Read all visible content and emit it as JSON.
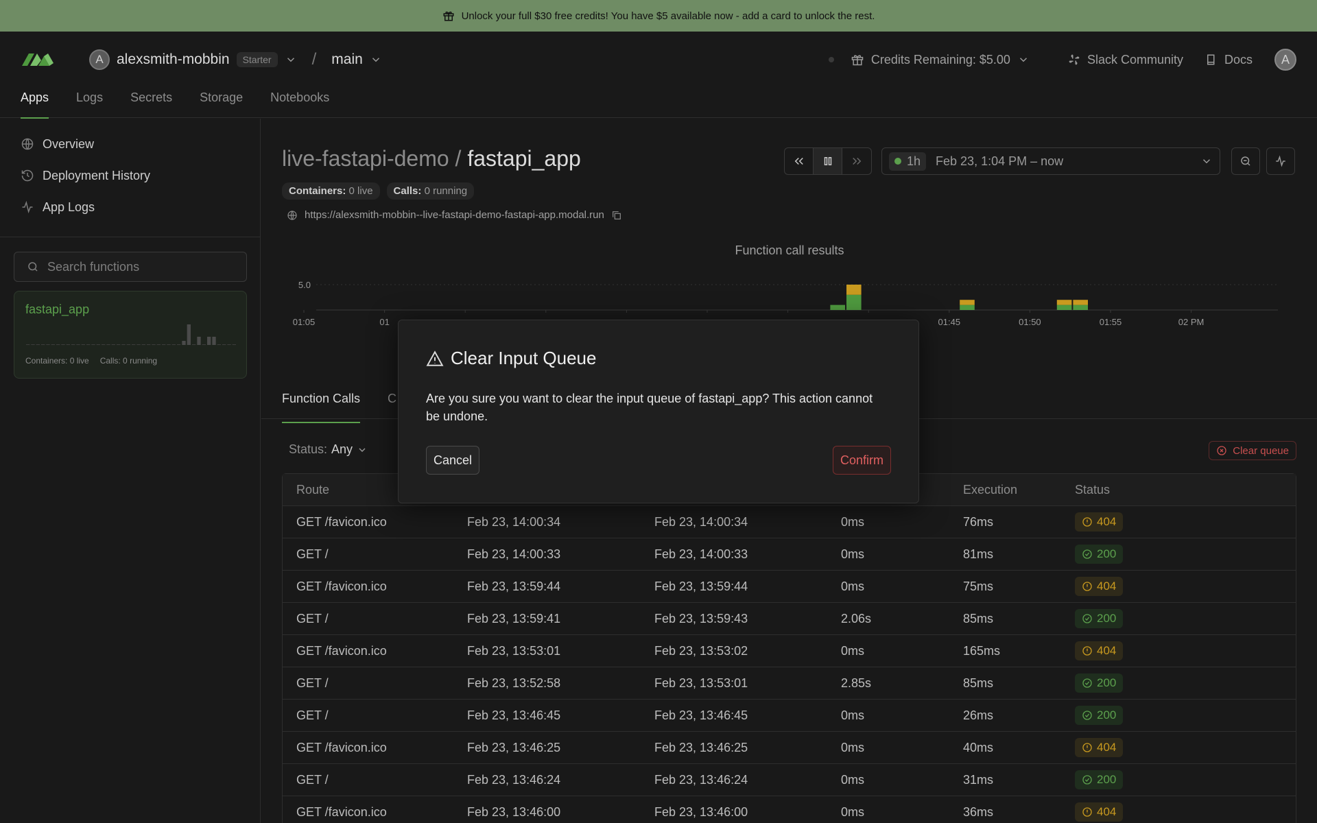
{
  "banner": {
    "text": "Unlock your full $30 free credits! You have $5 available now - add a card to unlock the rest."
  },
  "header": {
    "org_avatar": "A",
    "org_name": "alexsmith-mobbin",
    "plan": "Starter",
    "separator": "/",
    "branch": "main",
    "credits": "Credits Remaining: $5.00",
    "slack": "Slack Community",
    "docs": "Docs",
    "user_avatar": "A"
  },
  "nav": {
    "tabs": [
      {
        "label": "Apps",
        "active": true
      },
      {
        "label": "Logs"
      },
      {
        "label": "Secrets"
      },
      {
        "label": "Storage"
      },
      {
        "label": "Notebooks"
      }
    ]
  },
  "sidebar": {
    "links": [
      {
        "label": "Overview",
        "icon": "globe-icon"
      },
      {
        "label": "Deployment History",
        "icon": "history-icon"
      },
      {
        "label": "App Logs",
        "icon": "activity-icon"
      }
    ],
    "search_placeholder": "Search functions",
    "function_card": {
      "name": "fastapi_app",
      "containers": "Containers: 0 live",
      "calls": "Calls: 0 running",
      "sparkline": [
        0,
        0,
        0,
        0,
        0,
        0,
        0,
        0,
        0,
        0,
        0,
        0,
        0,
        0,
        0,
        0,
        0,
        0,
        0,
        0,
        0,
        0,
        0,
        0,
        0,
        0,
        0,
        0,
        0,
        0,
        0,
        1,
        5,
        0,
        2,
        0,
        2,
        2,
        0,
        0,
        0,
        0
      ]
    }
  },
  "main": {
    "app_prefix": "live-fastapi-demo",
    "title_sep": " / ",
    "app_name": "fastapi_app",
    "containers_label": "Containers:",
    "containers_value": "0 live",
    "calls_label": "Calls:",
    "calls_value": "0 running",
    "url": "https://alexsmith-mobbin--live-fastapi-demo-fastapi-app.modal.run",
    "range_chip": "1h",
    "range_text": "Feb 23, 1:04 PM – now",
    "subtabs": [
      {
        "label": "Function Calls",
        "active": true
      },
      {
        "label": "C"
      }
    ],
    "status_filter_label": "Status:",
    "status_filter_value": "Any",
    "clear_queue": "Clear queue",
    "colors": {
      "accent": "#5ca04d",
      "warn": "#c99a1f",
      "danger": "#c84f4f"
    }
  },
  "chart_data": {
    "type": "bar",
    "title": "Function call results",
    "stacked": true,
    "x_tick_labels": [
      "01:05",
      "01",
      "",
      "",
      "",
      "",
      "",
      "",
      "01:45",
      "01:50",
      "01:55",
      "02 PM"
    ],
    "y_tick_labels": [
      "5.0"
    ],
    "ylim": [
      0,
      5
    ],
    "series": [
      {
        "color": "#4f9a3f",
        "values": [
          [
            84,
            1
          ],
          [
            85,
            3
          ],
          [
            92,
            1
          ],
          [
            98,
            1
          ],
          [
            99,
            1
          ]
        ]
      },
      {
        "color": "#c99a1f",
        "values": [
          [
            85,
            2
          ],
          [
            92,
            1
          ],
          [
            98,
            1
          ],
          [
            99,
            1
          ]
        ]
      }
    ]
  },
  "table": {
    "headers": [
      "Route",
      "",
      "",
      "",
      "Execution",
      "Status"
    ],
    "rows": [
      [
        "GET /favicon.ico",
        "Feb 23, 14:00:34",
        "Feb 23, 14:00:34",
        "0ms",
        "76ms",
        "404"
      ],
      [
        "GET /",
        "Feb 23, 14:00:33",
        "Feb 23, 14:00:33",
        "0ms",
        "81ms",
        "200"
      ],
      [
        "GET /favicon.ico",
        "Feb 23, 13:59:44",
        "Feb 23, 13:59:44",
        "0ms",
        "75ms",
        "404"
      ],
      [
        "GET /",
        "Feb 23, 13:59:41",
        "Feb 23, 13:59:43",
        "2.06s",
        "85ms",
        "200"
      ],
      [
        "GET /favicon.ico",
        "Feb 23, 13:53:01",
        "Feb 23, 13:53:02",
        "0ms",
        "165ms",
        "404"
      ],
      [
        "GET /",
        "Feb 23, 13:52:58",
        "Feb 23, 13:53:01",
        "2.85s",
        "85ms",
        "200"
      ],
      [
        "GET /",
        "Feb 23, 13:46:45",
        "Feb 23, 13:46:45",
        "0ms",
        "26ms",
        "200"
      ],
      [
        "GET /favicon.ico",
        "Feb 23, 13:46:25",
        "Feb 23, 13:46:25",
        "0ms",
        "40ms",
        "404"
      ],
      [
        "GET /",
        "Feb 23, 13:46:24",
        "Feb 23, 13:46:24",
        "0ms",
        "31ms",
        "200"
      ],
      [
        "GET /favicon.ico",
        "Feb 23, 13:46:00",
        "Feb 23, 13:46:00",
        "0ms",
        "36ms",
        "404"
      ]
    ]
  },
  "modal": {
    "title": "Clear Input Queue",
    "body": "Are you sure you want to clear the input queue of fastapi_app? This action cannot be undone.",
    "cancel": "Cancel",
    "confirm": "Confirm"
  }
}
